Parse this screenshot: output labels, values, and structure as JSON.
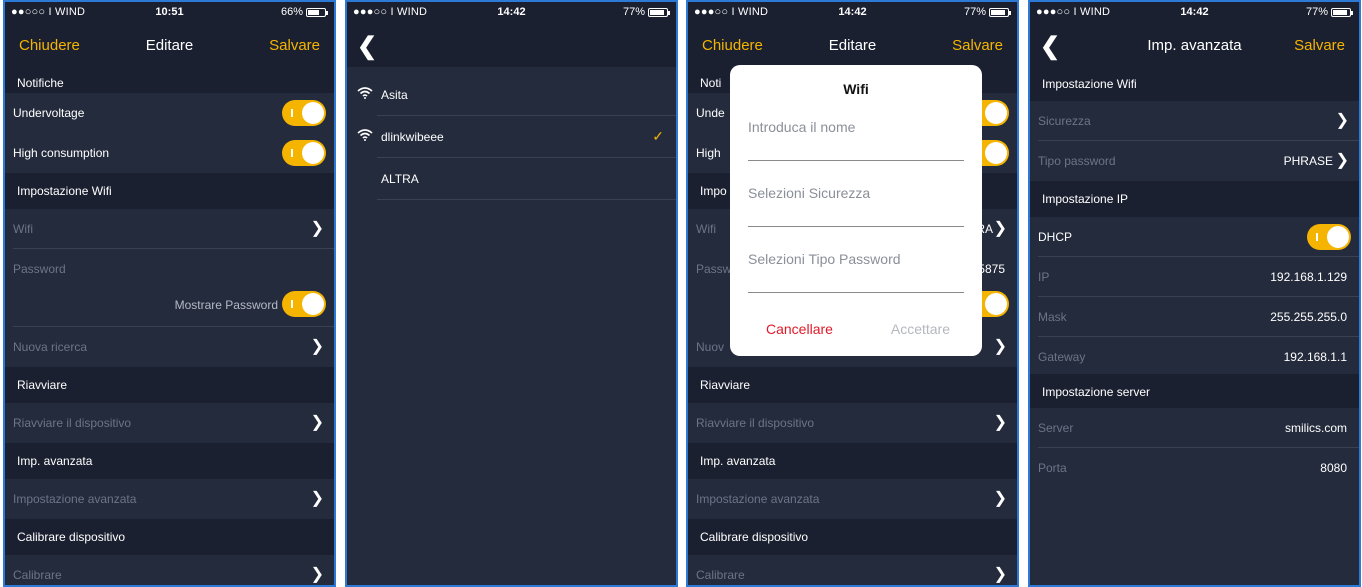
{
  "colors": {
    "accent": "#f5b400",
    "background": "#242b3c",
    "section": "#1b2030",
    "danger": "#e0192a"
  },
  "screens": [
    {
      "status": {
        "carrier": "●●○○○ I WIND",
        "time": "10:51",
        "battery": "66%",
        "battery_level": 0.66
      },
      "nav": {
        "left": "Chiudere",
        "title": "Editare",
        "right": "Salvare"
      },
      "rows": {
        "notifiche": "Notifiche",
        "undervoltage": "Undervoltage",
        "high_consumption": "High consumption",
        "impostazione_wifi": "Impostazione Wifi",
        "wifi": "Wifi",
        "password": "Password",
        "mostrare_password": "Mostrare Password",
        "nuova_ricerca": "Nuova ricerca",
        "riavviare": "Riavviare",
        "riavviare_dispositivo": "Riavviare il dispositivo",
        "imp_avanzata": "Imp. avanzata",
        "impostazione_avanzata": "Impostazione avanzata",
        "calibrare_dispositivo": "Calibrare dispositivo",
        "calibrare": "Calibrare"
      },
      "toggles": {
        "undervoltage": true,
        "high_consumption": true,
        "mostrare_password": true
      }
    },
    {
      "status": {
        "carrier": "●●●○○ I WIND",
        "time": "14:42",
        "battery": "77%",
        "battery_level": 0.77
      },
      "networks": [
        {
          "name": "Asita",
          "selected": false,
          "icon": "wifi-icon"
        },
        {
          "name": "dlinkwibeee",
          "selected": true,
          "icon": "wifi-icon"
        },
        {
          "name": "ALTRA",
          "selected": false
        }
      ]
    },
    {
      "status": {
        "carrier": "●●●○○ I WIND",
        "time": "14:42",
        "battery": "77%",
        "battery_level": 0.77
      },
      "nav": {
        "left": "Chiudere",
        "title": "Editare",
        "right": "Salvare"
      },
      "background_fragments": {
        "noti": "Noti",
        "unde": "Unde",
        "high": "High",
        "impo": "Impo",
        "wifi": "Wifi",
        "wifi_value": "RA",
        "passw": "Passw",
        "passw_value": "5875",
        "nuov": "Nuov",
        "riavviare": "Riavviare",
        "riavviare_dispositivo": "Riavviare il dispositivo",
        "imp_avanzata": "Imp. avanzata",
        "impostazione_avanzata": "Impostazione avanzata",
        "calibrare_dispositivo": "Calibrare dispositivo",
        "calibrare": "Calibrare"
      },
      "dialog": {
        "title": "Wifi",
        "name_placeholder": "Introduca il nome",
        "security_placeholder": "Selezioni Sicurezza",
        "password_type_placeholder": "Selezioni Tipo Password",
        "cancel": "Cancellare",
        "accept": "Accettare"
      }
    },
    {
      "status": {
        "carrier": "●●●○○ I WIND",
        "time": "14:42",
        "battery": "77%",
        "battery_level": 0.77
      },
      "nav": {
        "title": "Imp. avanzata",
        "right": "Salvare"
      },
      "rows": {
        "impostazione_wifi": "Impostazione Wifi",
        "sicurezza": "Sicurezza",
        "tipo_password": "Tipo password",
        "tipo_password_value": "PHRASE",
        "impostazione_ip": "Impostazione IP",
        "dhcp": "DHCP",
        "ip": "IP",
        "ip_value": "192.168.1.129",
        "mask": "Mask",
        "mask_value": "255.255.255.0",
        "gateway": "Gateway",
        "gateway_value": "192.168.1.1",
        "impostazione_server": "Impostazione server",
        "server": "Server",
        "server_value": "smilics.com",
        "porta": "Porta",
        "porta_value": "8080"
      },
      "toggles": {
        "dhcp": true
      }
    }
  ]
}
